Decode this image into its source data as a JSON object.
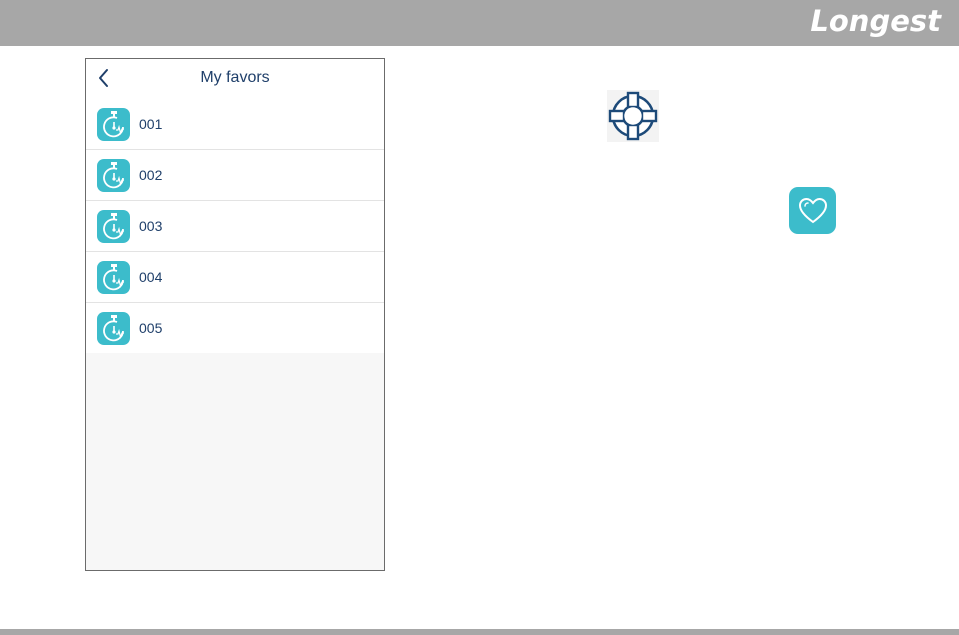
{
  "brand": {
    "logo_text": "Longest"
  },
  "phone": {
    "title": "My favors",
    "back_icon": "chevron-left-icon",
    "items": [
      {
        "label": "001",
        "icon": "stopwatch-icon"
      },
      {
        "label": "002",
        "icon": "stopwatch-icon"
      },
      {
        "label": "003",
        "icon": "stopwatch-icon"
      },
      {
        "label": "004",
        "icon": "stopwatch-icon"
      },
      {
        "label": "005",
        "icon": "stopwatch-icon"
      }
    ]
  },
  "callouts": {
    "help_icon": "lifebuoy-icon",
    "favorite_icon": "heart-icon"
  },
  "colors": {
    "accent": "#3cbccb",
    "text_dark_blue": "#1f3f6a",
    "bar_gray": "#a7a7a7"
  }
}
